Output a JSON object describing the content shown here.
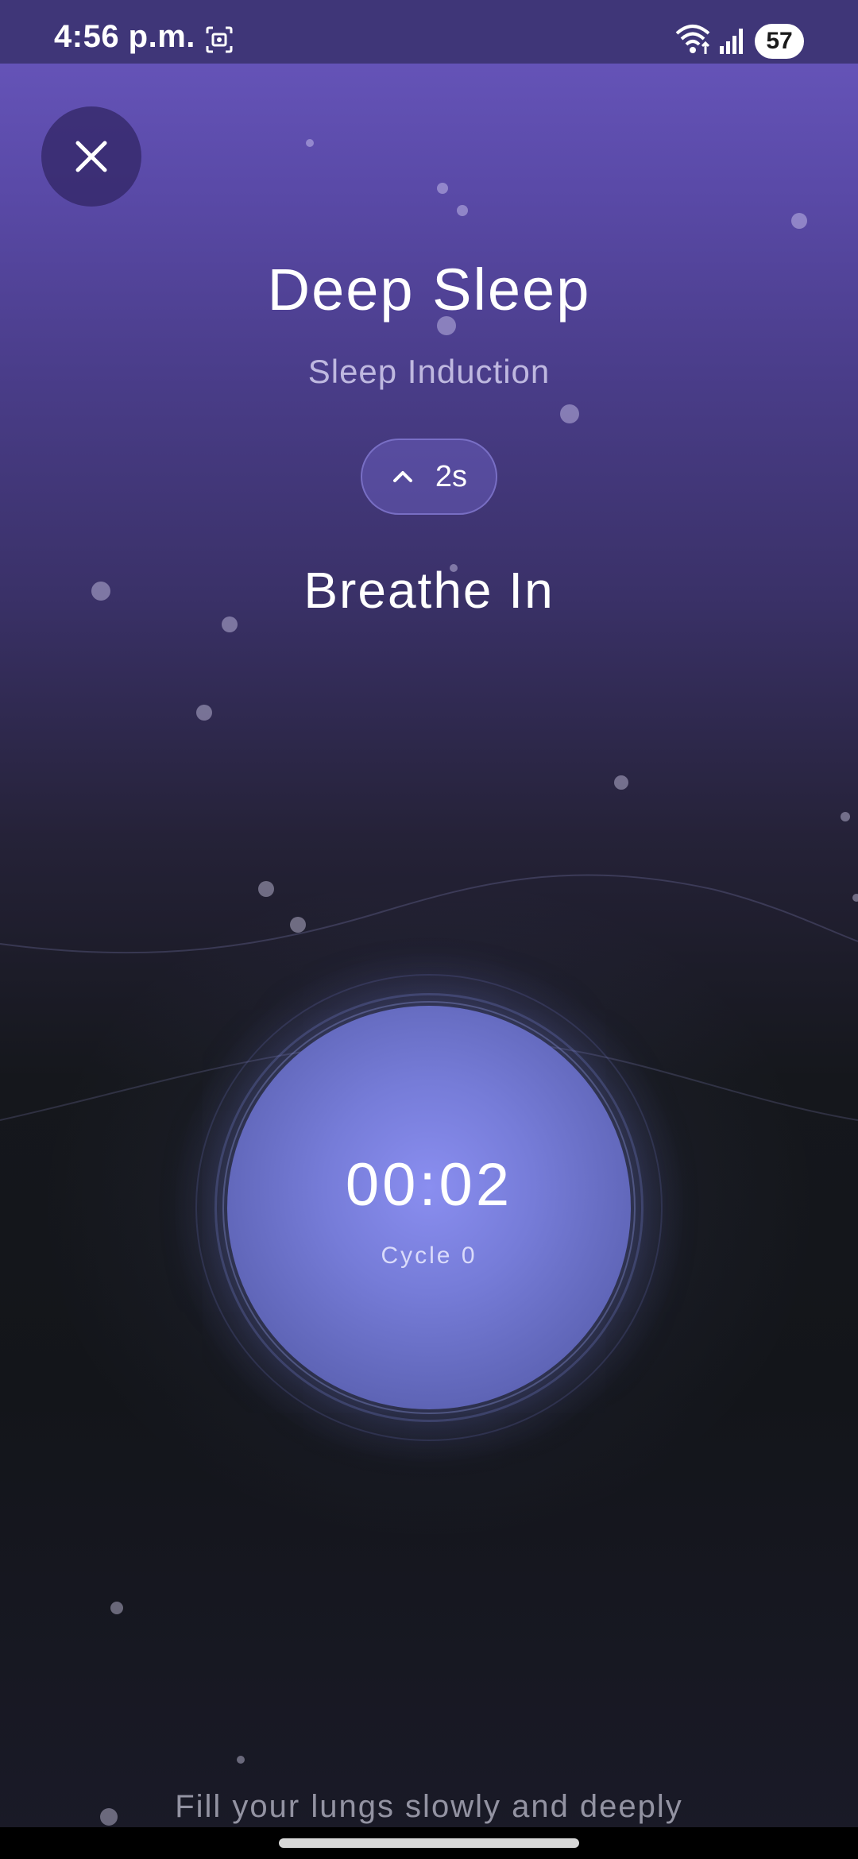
{
  "status_bar": {
    "time": "4:56 p.m.",
    "battery": "57",
    "icons": [
      "screenshot-icon",
      "wifi-icon",
      "signal-icon",
      "battery-icon"
    ]
  },
  "session": {
    "title": "Deep Sleep",
    "subtitle": "Sleep Induction",
    "duration": "2s",
    "phase": "Breathe In",
    "timer": "00:02",
    "cycle": "Cycle 0",
    "instruction": "Fill your lungs slowly and deeply"
  },
  "colors": {
    "background_top": "#6a58bf",
    "background_bottom": "#13151a",
    "orb": "#767cd8",
    "accent": "#8a8ef0"
  }
}
